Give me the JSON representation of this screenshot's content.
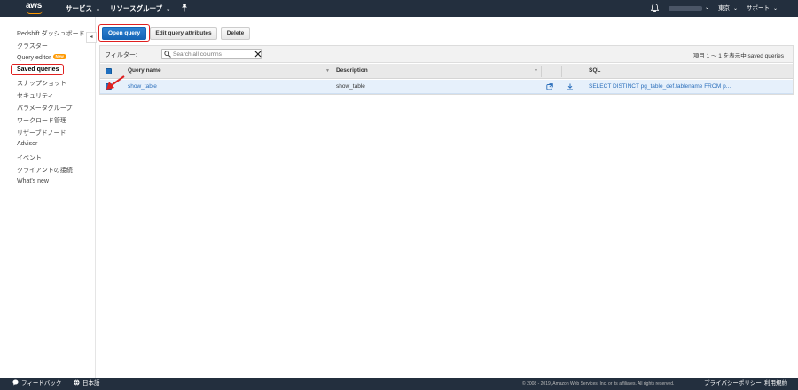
{
  "topbar": {
    "logo": "aws",
    "services": "サービス",
    "resource_groups": "リソースグループ",
    "region": "東京",
    "support": "サポート",
    "caret": "⌄"
  },
  "sidebar": {
    "items": [
      {
        "label": "Redshift ダッシュボード"
      },
      {
        "label": "クラスター"
      },
      {
        "label": "Query editor",
        "badge": "New"
      },
      {
        "label": "Saved queries",
        "active": true
      },
      {
        "label": "スナップショット"
      },
      {
        "label": "セキュリティ"
      },
      {
        "label": "パラメータグループ"
      },
      {
        "label": "ワークロード管理"
      },
      {
        "label": "リザーブドノード"
      },
      {
        "label": "Advisor"
      },
      {
        "label": "イベント"
      },
      {
        "label": "クライアントの接続"
      },
      {
        "label": "What's new"
      }
    ]
  },
  "toolbar": {
    "open_query": "Open query",
    "edit_attributes": "Edit query attributes",
    "delete": "Delete"
  },
  "filter": {
    "label": "フィルター:",
    "placeholder": "Search all columns",
    "pager": "項目 1 ～ 1 を表示中 saved queries"
  },
  "table": {
    "columns": [
      "Query name",
      "Description",
      "SQL"
    ],
    "rows": [
      {
        "name": "show_table",
        "description": "show_table",
        "sql": "SELECT DISTINCT pg_table_def.tablename FROM p..."
      }
    ]
  },
  "footer": {
    "feedback": "フィードバック",
    "language": "日本語",
    "copyright": "© 2008 - 2019, Amazon Web Services, Inc. or its affiliates. All rights reserved.",
    "privacy": "プライバシーポリシー",
    "terms": "利用規約"
  },
  "colors": {
    "nav_bg": "#232f3e",
    "accent_orange": "#ff9900",
    "primary_blue": "#1f6fbf",
    "highlight_red": "#e02020",
    "selected_row": "#e6f0fb"
  }
}
